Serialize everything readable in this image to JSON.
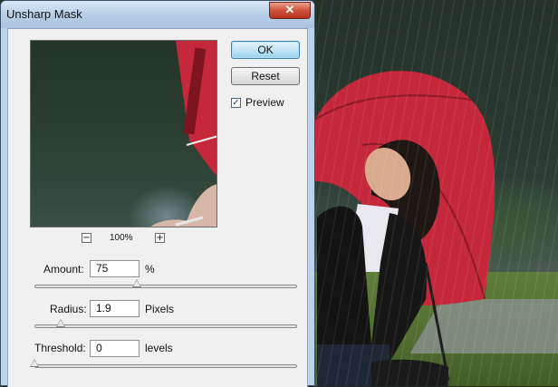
{
  "dialog": {
    "title": "Unsharp Mask",
    "close_glyph": "✕"
  },
  "preview": {
    "zoom_out_glyph": "−",
    "zoom_in_glyph": "+",
    "zoom_level": "100%"
  },
  "buttons": {
    "ok": "OK",
    "reset": "Reset"
  },
  "preview_toggle": {
    "label": "Preview",
    "checked": true,
    "glyph": "✓"
  },
  "controls": {
    "amount": {
      "label": "Amount:",
      "value": "75",
      "unit": "%",
      "slider_fraction": 0.39
    },
    "radius": {
      "label": "Radius:",
      "value": "1.9",
      "unit": "Pixels",
      "slider_fraction": 0.1
    },
    "threshold": {
      "label": "Threshold:",
      "value": "0",
      "unit": "levels",
      "slider_fraction": 0.0
    }
  },
  "colors": {
    "umbrella_red": "#c4283a",
    "dialog_frame": "#bcd2ea",
    "ok_button": "#98d1ef"
  }
}
